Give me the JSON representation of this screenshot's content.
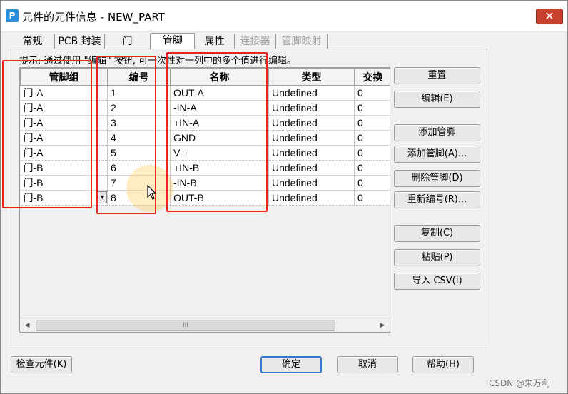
{
  "window": {
    "title": "元件的元件信息 - NEW_PART",
    "app_icon": "P",
    "close_glyph": "✕"
  },
  "tabs": [
    {
      "label": "常规",
      "state": "normal"
    },
    {
      "label": "PCB 封装",
      "state": "normal"
    },
    {
      "label": "门",
      "state": "normal"
    },
    {
      "label": "管脚",
      "state": "active"
    },
    {
      "label": "属性",
      "state": "normal"
    },
    {
      "label": "连接器",
      "state": "disabled"
    },
    {
      "label": "管脚映射",
      "state": "disabled"
    }
  ],
  "hint": "提示: 通过使用 \"编辑\" 按钮, 可一次性对一列中的多个值进行编辑。",
  "grid": {
    "columns": [
      "管脚组",
      "编号",
      "名称",
      "类型",
      "交换"
    ],
    "rows": [
      [
        "门-A",
        "1",
        "OUT-A",
        "Undefined",
        "0"
      ],
      [
        "门-A",
        "2",
        "-IN-A",
        "Undefined",
        "0"
      ],
      [
        "门-A",
        "3",
        "+IN-A",
        "Undefined",
        "0"
      ],
      [
        "门-A",
        "4",
        "GND",
        "Undefined",
        "0"
      ],
      [
        "门-A",
        "5",
        "V+",
        "Undefined",
        "0"
      ],
      [
        "门-B",
        "6",
        "+IN-B",
        "Undefined",
        "0"
      ],
      [
        "门-B",
        "7",
        "-IN-B",
        "Undefined",
        "0"
      ],
      [
        "门-B",
        "8",
        "OUT-B",
        "Undefined",
        "0"
      ]
    ],
    "combo_arrow": "▼"
  },
  "scrollbar": {
    "left": "◀",
    "right": "▶",
    "grip": "III"
  },
  "side_buttons": {
    "reset": "重置",
    "edit": "编辑(E)",
    "add_pin": "添加管脚",
    "add_pins": "添加管脚(A)...",
    "delete_pin": "删除管脚(D)",
    "renumber": "重新编号(R)...",
    "copy": "复制(C)",
    "paste": "粘贴(P)",
    "import_csv": "导入 CSV(I)"
  },
  "bottom_buttons": {
    "check": "检查元件(K)",
    "ok": "确定",
    "cancel": "取消",
    "help": "帮助(H)"
  },
  "watermark": "CSDN @朱万利",
  "colors": {
    "annotation": "#e8261d",
    "close": "#c8402e",
    "default_focus": "#3a76c8"
  }
}
